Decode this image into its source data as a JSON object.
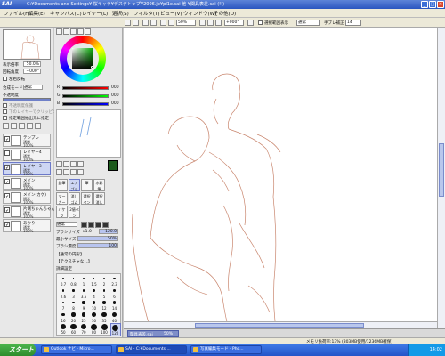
{
  "app": {
    "logo": "SAI",
    "title": "C:¥Documents and Settings¥ 桜キャラ¥デスクトップ¥2006.jp¥pl1e.sai 他 ¥関具表差.sai (!!)"
  },
  "window_buttons": [
    "_",
    "□",
    "×"
  ],
  "menu": [
    "ファイル(F)",
    "編集(E)",
    "キャンバス(C)",
    "レイヤー(L)",
    "選択(S)",
    "フィルタ(T)",
    "ビュー(V)",
    "ウィンドウ(W)",
    "その他(O)"
  ],
  "toolbar": {
    "zoom": "50%",
    "angle": "+000°",
    "stabilizer_checkbox_label": "選択範囲表示",
    "blend_label": "通常",
    "correction_label": "手ブレ補正",
    "correction_value": "14"
  },
  "navigator": {
    "zoom_label": "表示倍率",
    "zoom_value": "50.0%",
    "rotate_label": "回転角度",
    "rotate_value": "+000°",
    "flip_label": "左右反転"
  },
  "layer_props": {
    "composite_mode_label": "合成モード",
    "composite_mode_value": "通常",
    "opacity_label": "不透明度",
    "opacity_value": "100%",
    "protect_opacity": "不透明度保護",
    "clipping": "下のレイヤーでクリッピング",
    "selection_source": "指定範囲抽出元に指定"
  },
  "layers": [
    {
      "name": "テンプレ",
      "mode": "通常",
      "opacity": "100%",
      "visible": true,
      "selected": false
    },
    {
      "name": "レイヤー4",
      "mode": "通常",
      "opacity": "100%",
      "visible": false,
      "selected": false
    },
    {
      "name": "レイヤー3",
      "mode": "通常",
      "opacity": "100%",
      "visible": true,
      "selected": true
    },
    {
      "name": "メイン",
      "mode": "通常",
      "opacity": "100%",
      "visible": true,
      "selected": false
    },
    {
      "name": "メイン(カゲ)",
      "mode": "通常",
      "opacity": "100%",
      "visible": true,
      "selected": false
    },
    {
      "name": "片側ちゃんちゃん",
      "mode": "通常",
      "opacity": "100%",
      "visible": true,
      "selected": false
    },
    {
      "name": "あかり",
      "mode": "通常",
      "opacity": "100%",
      "visible": true,
      "selected": false
    }
  ],
  "color_sliders": [
    {
      "label": "R",
      "value": "000"
    },
    {
      "label": "G",
      "value": "000"
    },
    {
      "label": "B",
      "value": "000"
    }
  ],
  "tools": [
    {
      "label": "鉛筆",
      "selected": false
    },
    {
      "label": "エアブラシ",
      "selected": true
    },
    {
      "label": "筆",
      "selected": false
    },
    {
      "label": "水彩筆",
      "selected": false
    },
    {
      "label": "マーカー",
      "selected": false
    },
    {
      "label": "消しゴム",
      "selected": false
    },
    {
      "label": "選択ペン",
      "selected": false
    },
    {
      "label": "選択消し",
      "selected": false
    },
    {
      "label": "バケツ",
      "selected": false
    },
    {
      "label": "2値ペン",
      "selected": false
    }
  ],
  "brush": {
    "blend_mode": "通常",
    "size_label": "ブラシサイズ",
    "size_mult": "x1.0",
    "size_value": "120.0",
    "min_size_label": "最小サイズ",
    "min_size_value": "50%",
    "density_label": "ブラシ濃度",
    "density_value": "100",
    "shape_label": "【通常の円形】",
    "texture_label": "【テクスチャなし】",
    "detail_label": "詳細設定"
  },
  "brush_sizes": [
    "0.7",
    "0.8",
    "1",
    "1.5",
    "2",
    "2.3",
    "2.6",
    "3",
    "3.5",
    "4",
    "5",
    "6",
    "7",
    "8",
    "9",
    "10",
    "12",
    "14",
    "16",
    "20",
    "25",
    "30",
    "35",
    "40",
    "50",
    "60",
    "70",
    "80",
    "100",
    "120"
  ],
  "file_tab": "関具表差.sai",
  "file_tab_zoom": "50%",
  "status": "メモリ負荷率:13%  (803MB使用/1236MB確保)",
  "taskbar": {
    "start": "スタート",
    "tasks": [
      {
        "label": "Outlook ナビ - Micro...",
        "active": false
      },
      {
        "label": "SAI - C:¥Documents ...",
        "active": true
      },
      {
        "label": "写真編集モード - Pho...",
        "active": false
      }
    ],
    "clock": "14:02"
  },
  "colors": {
    "accent": "#2a56c0",
    "selected_layer": "#cdd6f3",
    "line_art": "#c9866e",
    "current_color": "#1c5a1c"
  }
}
